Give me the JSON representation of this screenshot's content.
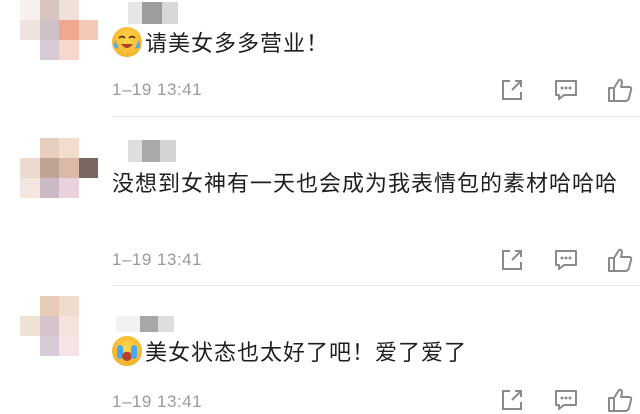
{
  "comments": [
    {
      "emoji": "tears-of-joy-emoji",
      "text": "请美女多多营业！",
      "timestamp": "1–19 13:41"
    },
    {
      "emoji": "",
      "text": "没想到女神有一天也会成为我表情包的素材哈哈哈",
      "timestamp": "1–19 13:41"
    },
    {
      "emoji": "crying-emoji",
      "text": "美女状态也太好了吧！爱了爱了",
      "timestamp": "1–19 13:41"
    }
  ],
  "actions": {
    "share_icon": "share-icon",
    "reply_icon": "comment-icon",
    "like_icon": "thumbs-up-icon"
  },
  "colors": {
    "text": "#1f1f1f",
    "meta": "#9a9a9a",
    "icon": "#8a8a8a",
    "divider": "#e8e8e8"
  }
}
